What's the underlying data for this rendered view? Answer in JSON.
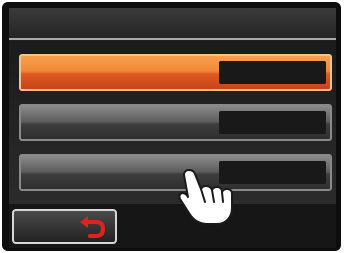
{
  "screen": {
    "header": {
      "title": ""
    },
    "menu": {
      "items": [
        {
          "label": "",
          "value": "",
          "state": "selected"
        },
        {
          "label": "",
          "value": "",
          "state": "normal"
        },
        {
          "label": "",
          "value": "",
          "state": "normal"
        }
      ]
    },
    "footer": {
      "back_button": {
        "icon": "return-arrow-icon"
      }
    }
  },
  "overlay": {
    "icon": "hand-pointer-icon"
  },
  "colors": {
    "selected_item": "#f2883a",
    "back_arrow": "#e2211c",
    "screen_bg": "#1f1f1f"
  }
}
